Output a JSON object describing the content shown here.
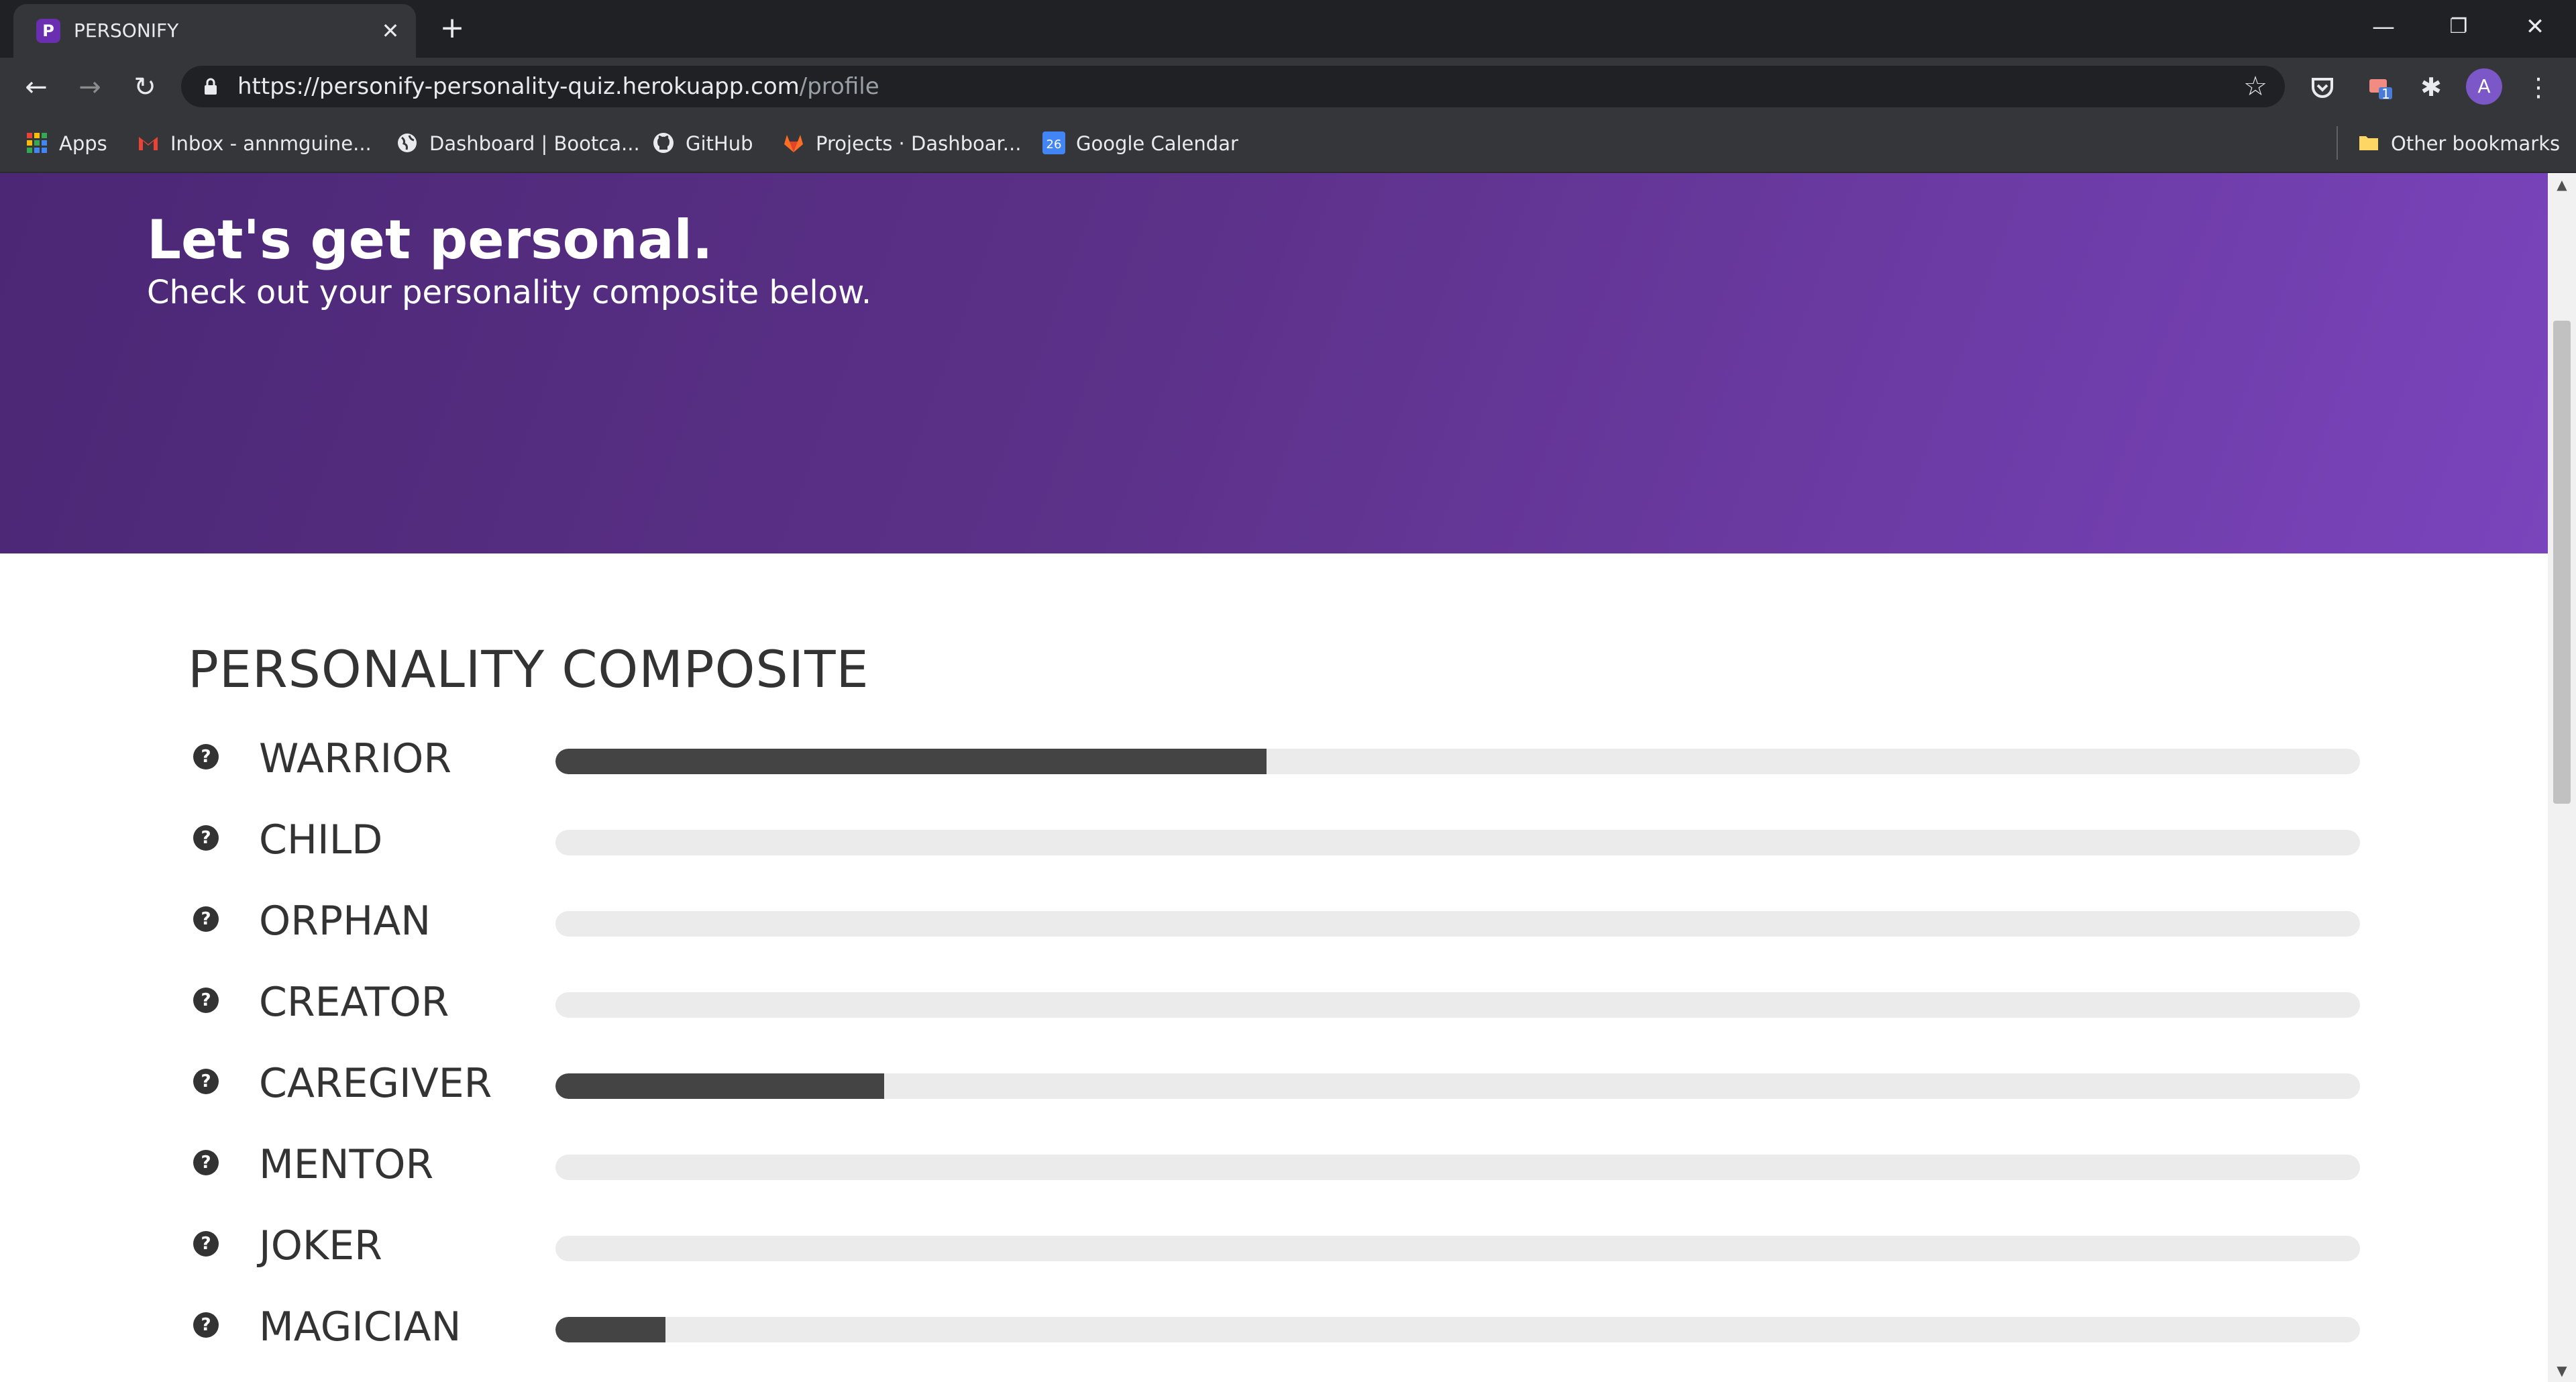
{
  "browser": {
    "tab": {
      "title": "PERSONIFY",
      "favicon": "P",
      "close": "✕"
    },
    "new_tab": "+",
    "window_controls": {
      "minimize": "—",
      "restore": "❐",
      "close": "✕"
    },
    "nav": {
      "back": "←",
      "forward": "→",
      "reload": "↻"
    },
    "url": {
      "base": "https://personify-personality-quiz.herokuapp.com",
      "path": "/profile"
    },
    "star": "☆",
    "extension_badge": "1",
    "avatar": "A",
    "bookmarks": [
      {
        "label": "Apps",
        "icon": "apps-grid-icon"
      },
      {
        "label": "Inbox - annmguine...",
        "icon": "gmail-icon"
      },
      {
        "label": "Dashboard | Bootca...",
        "icon": "globe-icon"
      },
      {
        "label": "GitHub",
        "icon": "github-icon"
      },
      {
        "label": "Projects · Dashboar...",
        "icon": "gitlab-icon"
      },
      {
        "label": "Google Calendar",
        "icon": "calendar-icon",
        "icon_text": "26"
      }
    ],
    "other_bookmarks": "Other bookmarks"
  },
  "hero": {
    "title": "Let's get personal.",
    "subtitle": "Check out your personality composite below."
  },
  "composite": {
    "heading": "PERSONALITY COMPOSITE",
    "help_glyph": "?",
    "traits": [
      {
        "label": "WARRIOR",
        "value": 0.394
      },
      {
        "label": "CHILD",
        "value": 0
      },
      {
        "label": "ORPHAN",
        "value": 0
      },
      {
        "label": "CREATOR",
        "value": 0
      },
      {
        "label": "CAREGIVER",
        "value": 0.182
      },
      {
        "label": "MENTOR",
        "value": 0
      },
      {
        "label": "JOKER",
        "value": 0
      },
      {
        "label": "MAGICIAN",
        "value": 0.061
      }
    ]
  },
  "colors": {
    "hero_start": "#4b2775",
    "hero_end": "#7a44bc",
    "bar_fill": "#444444",
    "bar_track": "#ebebeb",
    "text": "#333333"
  }
}
